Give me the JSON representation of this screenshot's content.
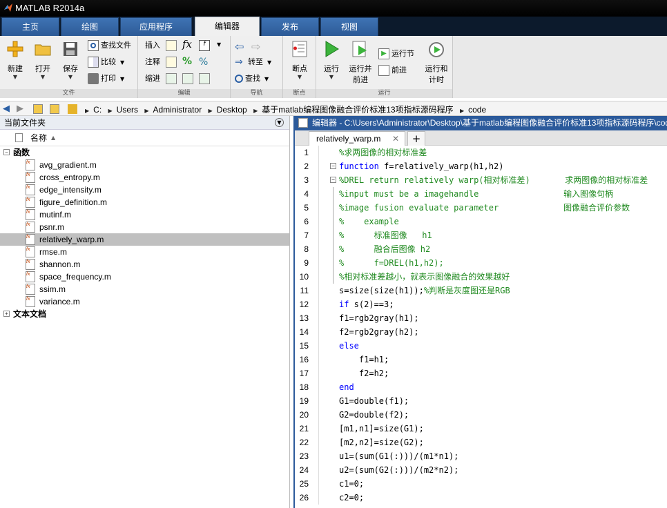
{
  "window": {
    "title": "MATLAB R2014a"
  },
  "tabs": [
    {
      "label": "主页",
      "active": false
    },
    {
      "label": "绘图",
      "active": false
    },
    {
      "label": "应用程序",
      "active": false
    },
    {
      "label": "编辑器",
      "active": true
    },
    {
      "label": "发布",
      "active": false
    },
    {
      "label": "视图",
      "active": false
    }
  ],
  "ribbon": {
    "file": {
      "group_label": "文件",
      "new": "新建",
      "open": "打开",
      "save": "保存",
      "find_files": "查找文件",
      "compare": "比较",
      "print": "打印"
    },
    "edit": {
      "group_label": "编辑",
      "insert": "插入",
      "comment": "注释",
      "indent": "缩进"
    },
    "navigate": {
      "group_label": "导航",
      "goto": "转至",
      "find": "查找"
    },
    "breakpoints": {
      "group_label": "断点",
      "breakpoints": "断点"
    },
    "run": {
      "group_label": "运行",
      "run": "运行",
      "run_advance_1": "运行并",
      "run_advance_2": "前进",
      "run_section": "运行节",
      "advance": "前进",
      "run_time_1": "运行和",
      "run_time_2": "计时"
    }
  },
  "address": {
    "crumbs": [
      "C:",
      "Users",
      "Administrator",
      "Desktop",
      "基于matlab编程图像融合评价标准13项指标源码程序",
      "code"
    ]
  },
  "current_folder": {
    "title": "当前文件夹",
    "col_name": "名称",
    "group_functions": "函数",
    "files": [
      "avg_gradient.m",
      "cross_entropy.m",
      "edge_intensity.m",
      "figure_definition.m",
      "mutinf.m",
      "psnr.m",
      "relatively_warp.m",
      "rmse.m",
      "shannon.m",
      "space_frequency.m",
      "ssim.m",
      "variance.m"
    ],
    "selected": "relatively_warp.m",
    "group_docs": "文本文档"
  },
  "editor": {
    "title": "编辑器 - C:\\Users\\Administrator\\Desktop\\基于matlab编程图像融合评价标准13项指标源码程序\\code\\relatively_warp.m",
    "tab": "relatively_warp.m",
    "lines": [
      {
        "n": "1",
        "segs": [
          {
            "t": "%求两图像的相对标准差",
            "c": "cm"
          }
        ]
      },
      {
        "n": "2",
        "segs": [
          {
            "t": "function",
            "c": "kw"
          },
          {
            "t": " f=relatively_warp(h1,h2)",
            "c": ""
          }
        ]
      },
      {
        "n": "3",
        "segs": [
          {
            "t": "%DREL return relatively warp(相对标准差)       求两图像的相对标准差",
            "c": "cm"
          }
        ]
      },
      {
        "n": "4",
        "segs": [
          {
            "t": "%input must be a imagehandle                 输入图像句柄",
            "c": "cm"
          }
        ]
      },
      {
        "n": "5",
        "segs": [
          {
            "t": "%image fusion evaluate parameter             图像融合评价参数",
            "c": "cm"
          }
        ]
      },
      {
        "n": "6",
        "segs": [
          {
            "t": "%    example",
            "c": "cm"
          }
        ]
      },
      {
        "n": "7",
        "segs": [
          {
            "t": "%      标准图像   h1",
            "c": "cm"
          }
        ]
      },
      {
        "n": "8",
        "segs": [
          {
            "t": "%      融合后图像 h2",
            "c": "cm"
          }
        ]
      },
      {
        "n": "9",
        "segs": [
          {
            "t": "%      f=DREL(h1,h2);",
            "c": "cm"
          }
        ]
      },
      {
        "n": "10",
        "segs": [
          {
            "t": "%相对标准差越小，就表示图像融合的效果越好",
            "c": "cm"
          }
        ]
      },
      {
        "n": "11",
        "segs": [
          {
            "t": "s=size(size(h1));",
            "c": ""
          },
          {
            "t": "%判断是灰度图还是RGB",
            "c": "cm"
          }
        ]
      },
      {
        "n": "12",
        "segs": [
          {
            "t": "if",
            "c": "kw"
          },
          {
            "t": " s(2)==3;",
            "c": ""
          }
        ]
      },
      {
        "n": "13",
        "segs": [
          {
            "t": "f1=rgb2gray(h1);",
            "c": ""
          }
        ]
      },
      {
        "n": "14",
        "segs": [
          {
            "t": "f2=rgb2gray(h2);",
            "c": ""
          }
        ]
      },
      {
        "n": "15",
        "segs": [
          {
            "t": "else",
            "c": "kw"
          }
        ]
      },
      {
        "n": "16",
        "segs": [
          {
            "t": "    f1=h1;",
            "c": ""
          }
        ]
      },
      {
        "n": "17",
        "segs": [
          {
            "t": "    f2=h2;",
            "c": ""
          }
        ]
      },
      {
        "n": "18",
        "segs": [
          {
            "t": "end",
            "c": "kw"
          }
        ]
      },
      {
        "n": "19",
        "segs": [
          {
            "t": "G1=double(f1);",
            "c": ""
          }
        ]
      },
      {
        "n": "20",
        "segs": [
          {
            "t": "G2=double(f2);",
            "c": ""
          }
        ]
      },
      {
        "n": "21",
        "segs": [
          {
            "t": "[m1,n1]=size(G1);",
            "c": ""
          }
        ]
      },
      {
        "n": "22",
        "segs": [
          {
            "t": "[m2,n2]=size(G2);",
            "c": ""
          }
        ]
      },
      {
        "n": "23",
        "segs": [
          {
            "t": "u1=(sum(G1(:)))/(m1*n1);",
            "c": ""
          }
        ]
      },
      {
        "n": "24",
        "segs": [
          {
            "t": "u2=(sum(G2(:)))/(m2*n2);",
            "c": ""
          }
        ]
      },
      {
        "n": "25",
        "segs": [
          {
            "t": "c1=0;",
            "c": ""
          }
        ]
      },
      {
        "n": "26",
        "segs": [
          {
            "t": "c2=0;",
            "c": ""
          }
        ]
      }
    ]
  },
  "colors": {
    "title_bg": "#000000",
    "tab_blue": "#3f73b4",
    "editor_title": "#2b5a9b",
    "comment": "#228b22",
    "keyword": "#0000ff",
    "selected_row": "#c0c0c0"
  }
}
